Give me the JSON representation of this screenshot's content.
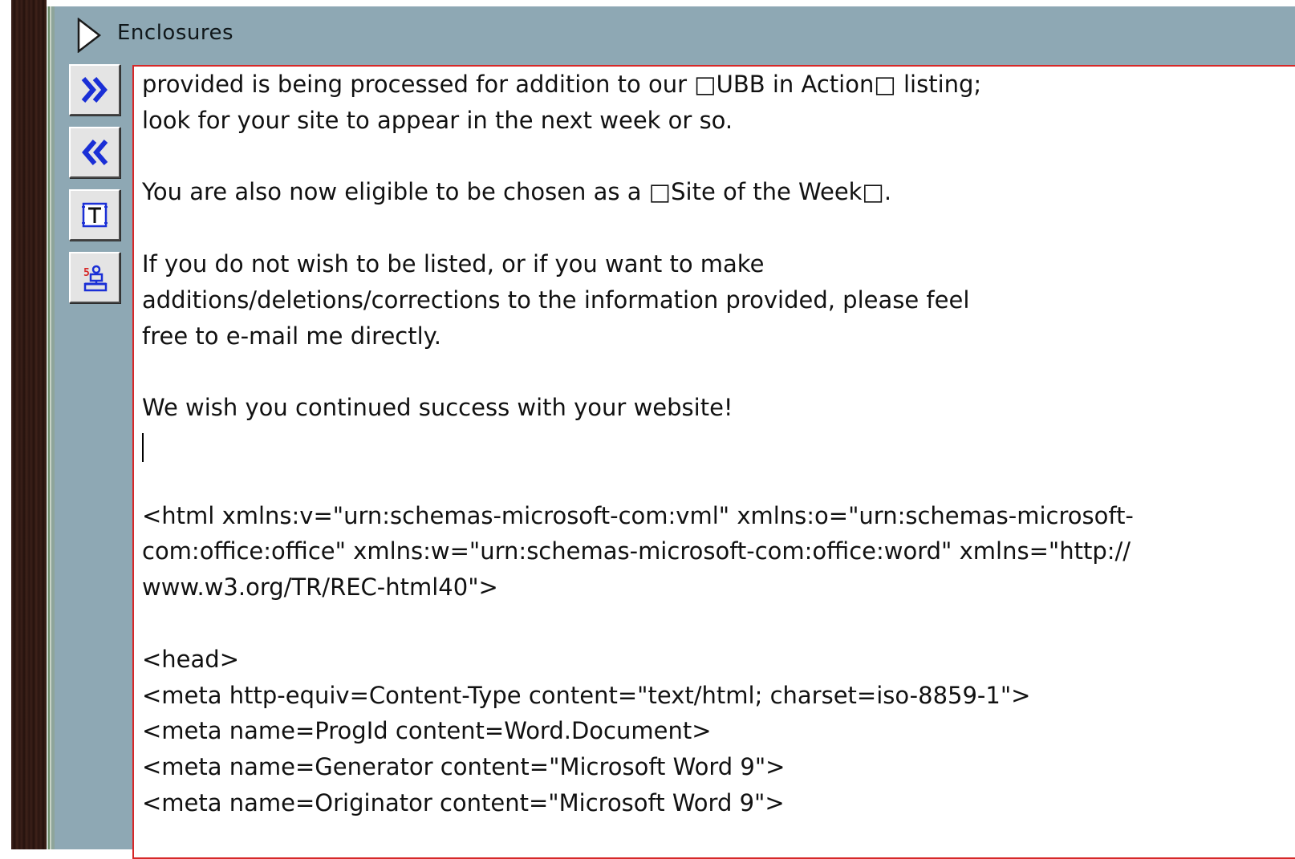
{
  "enclosures": {
    "title": "Enclosures"
  },
  "toolbar": {
    "buttons": [
      {
        "icon": "double-chevron-right-icon"
      },
      {
        "icon": "double-chevron-left-icon"
      },
      {
        "icon": "text-tag-icon"
      },
      {
        "icon": "person-network-icon"
      }
    ]
  },
  "message_body": {
    "lines": [
      "provided is being processed for addition to our □UBB in Action□ listing;",
      "look for your site to appear in the next week or so.",
      "",
      "You are also now eligible to be chosen as a □Site of the Week□.",
      "",
      "If you do not wish to be listed, or if you want to make",
      "additions/deletions/corrections to the information provided, please feel",
      "free to e-mail me directly.",
      "",
      "We wish you continued success with your website!",
      "",
      "",
      "<html xmlns:v=\"urn:schemas-microsoft-com:vml\" xmlns:o=\"urn:schemas-microsoft-",
      "com:office:office\" xmlns:w=\"urn:schemas-microsoft-com:office:word\" xmlns=\"http://",
      "www.w3.org/TR/REC-html40\">",
      "",
      "<head>",
      "<meta http-equiv=Content-Type content=\"text/html; charset=iso-8859-1\">",
      "<meta name=ProgId content=Word.Document>",
      "<meta name=Generator content=\"Microsoft Word 9\">",
      "<meta name=Originator content=\"Microsoft Word 9\">"
    ]
  },
  "colors": {
    "panel_background": "#8ea8b4",
    "editor_border": "#d62828",
    "button_icon_blue": "#1a2fd6"
  }
}
